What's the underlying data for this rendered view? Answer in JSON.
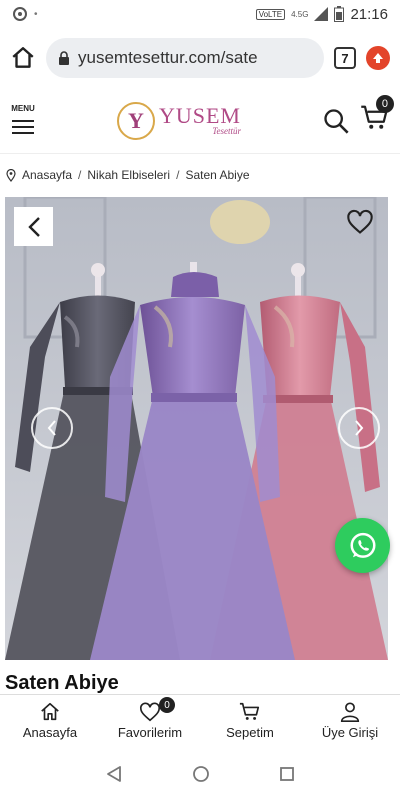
{
  "status": {
    "time": "21:16",
    "network": "4.5G",
    "volte": "VoLTE"
  },
  "browser": {
    "url": "yusemtesettur.com/sate",
    "tab_count": "7"
  },
  "header": {
    "menu_label": "MENU",
    "logo_name": "YUSEM",
    "logo_sub": "Tesettür",
    "logo_initial": "Y",
    "cart_count": "0"
  },
  "breadcrumb": {
    "items": [
      "Anasayfa",
      "Nikah Elbiseleri",
      "Saten Abiye"
    ],
    "separator": "/"
  },
  "product": {
    "title": "Saten Abiye"
  },
  "bottom_nav": {
    "home": "Anasayfa",
    "favorites": "Favorilerim",
    "favorites_count": "0",
    "cart": "Sepetim",
    "login": "Üye Girişi"
  },
  "icons": [
    "home-icon",
    "lock-icon",
    "tab-switcher-icon",
    "update-icon",
    "menu-icon",
    "search-icon",
    "cart-icon",
    "location-pin-icon",
    "chevron-left-icon",
    "heart-icon",
    "whatsapp-icon",
    "user-icon"
  ],
  "colors": {
    "brand": "#b04a86",
    "whatsapp": "#2ecc5e",
    "update": "#e3442a"
  }
}
